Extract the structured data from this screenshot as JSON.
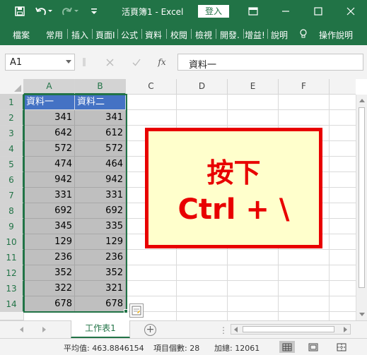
{
  "titlebar": {
    "title": "活頁簿1 - Excel",
    "signin_label": "登入"
  },
  "ribbon": {
    "tabs": [
      "檔案",
      "常用",
      "插入",
      "頁面I",
      "公式",
      "資料",
      "校閱",
      "檢視",
      "開發.",
      "增益!",
      "說明"
    ],
    "tell_me": "操作說明"
  },
  "formula_bar": {
    "name_box": "A1",
    "fx_label": "fx",
    "content": "資料一"
  },
  "columns": [
    "A",
    "B",
    "C",
    "D",
    "E",
    "F"
  ],
  "rows": [
    "1",
    "2",
    "3",
    "4",
    "5",
    "6",
    "7",
    "8",
    "9",
    "10",
    "11",
    "12",
    "13",
    "14"
  ],
  "table": {
    "headers": [
      "資料一",
      "資料二"
    ],
    "values": [
      [
        "341",
        "341"
      ],
      [
        "642",
        "612"
      ],
      [
        "572",
        "572"
      ],
      [
        "474",
        "464"
      ],
      [
        "942",
        "942"
      ],
      [
        "331",
        "331"
      ],
      [
        "692",
        "692"
      ],
      [
        "345",
        "335"
      ],
      [
        "129",
        "129"
      ],
      [
        "236",
        "236"
      ],
      [
        "352",
        "352"
      ],
      [
        "322",
        "321"
      ],
      [
        "678",
        "678"
      ]
    ]
  },
  "callout": {
    "line1": "按下",
    "line2": "Ctrl + \\"
  },
  "sheets": {
    "active": "工作表1"
  },
  "status": {
    "average": "平均值: 463.8846154",
    "count": "項目個數: 28",
    "sum": "加總: 12061"
  },
  "colors": {
    "excel_green": "#217346",
    "header_blue": "#4472c4",
    "callout_red": "#e80000",
    "callout_bg": "#ffffcc"
  }
}
